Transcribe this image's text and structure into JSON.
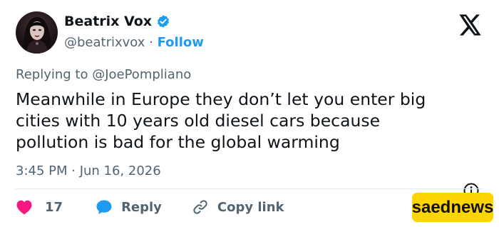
{
  "author": {
    "display_name": "Beatrix Vox",
    "handle": "@beatrixvox",
    "separator": "·",
    "follow_label": "Follow"
  },
  "tweet": {
    "reply_prefix": "Replying to ",
    "reply_mention": "@JoePompliano",
    "text": "Meanwhile in Europe they don’t let you enter big\ncities with 10 years old diesel cars because\npollution is bad for the global warming",
    "timestamp": "3:45 PM · Jun 16, 2026"
  },
  "actions": {
    "like_count": "17",
    "reply_label": "Reply",
    "copy_link_label": "Copy link"
  },
  "watermark": {
    "text": "saednews"
  },
  "colors": {
    "accent": "#1d9bf0",
    "like": "#f91880",
    "text": "#0f1419",
    "muted": "#536471",
    "watermark_bg": "#ffd500"
  }
}
